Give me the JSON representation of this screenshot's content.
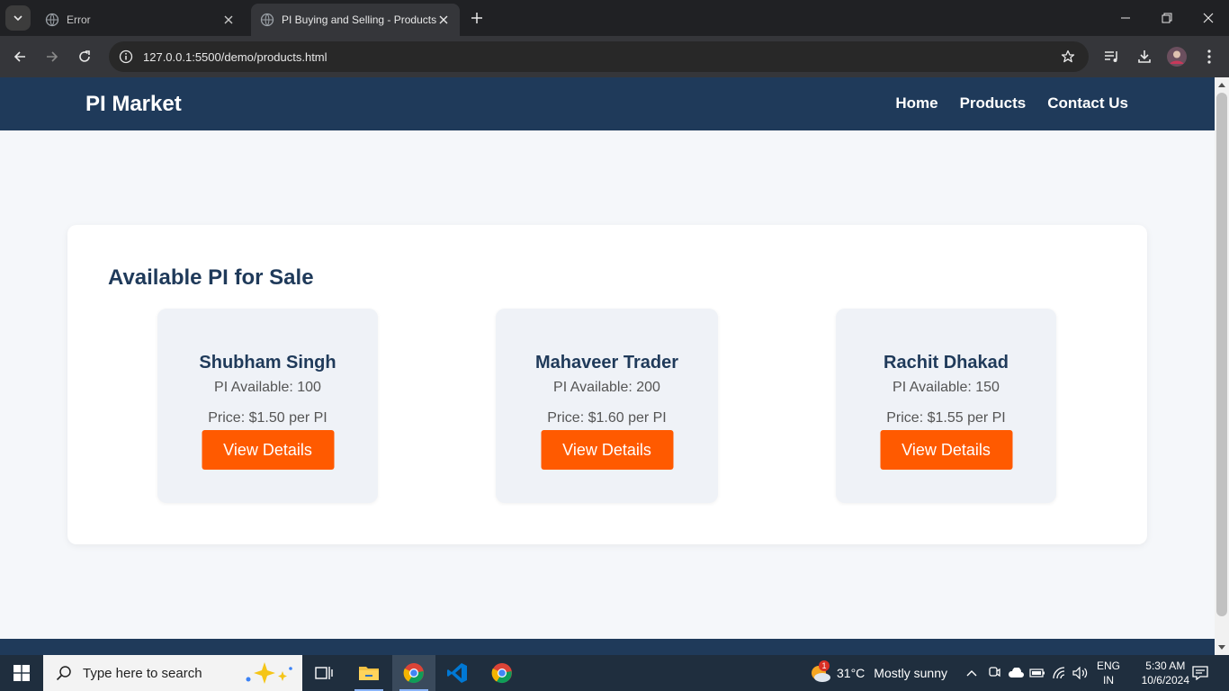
{
  "browser": {
    "tabs": [
      {
        "title": "Error",
        "active": false
      },
      {
        "title": "PI Buying and Selling - Products",
        "active": true
      }
    ],
    "url": "127.0.0.1:5500/demo/products.html"
  },
  "site": {
    "logo": "PI Market",
    "nav": [
      "Home",
      "Products",
      "Contact Us"
    ],
    "section_title": "Available PI for Sale",
    "listings": [
      {
        "seller": "Shubham Singh",
        "available": "PI Available: 100",
        "price": "Price: $1.50 per PI",
        "button": "View Details"
      },
      {
        "seller": "Mahaveer Trader",
        "available": "PI Available: 200",
        "price": "Price: $1.60 per PI",
        "button": "View Details"
      },
      {
        "seller": "Rachit Dhakad",
        "available": "PI Available: 150",
        "price": "Price: $1.55 per PI",
        "button": "View Details"
      }
    ],
    "colors": {
      "header": "#1f3a5a",
      "accent": "#ff5a00",
      "page_bg": "#f5f7fa",
      "card_bg": "#eff2f7"
    }
  },
  "taskbar": {
    "search_placeholder": "Type here to search",
    "weather": {
      "temp": "31°C",
      "condition": "Mostly sunny",
      "badge": "1"
    },
    "language": {
      "line1": "ENG",
      "line2": "IN"
    },
    "time": "5:30 AM",
    "date": "10/6/2024",
    "apps": [
      "file-explorer-icon",
      "chrome-icon",
      "vscode-icon",
      "chrome-icon"
    ]
  }
}
